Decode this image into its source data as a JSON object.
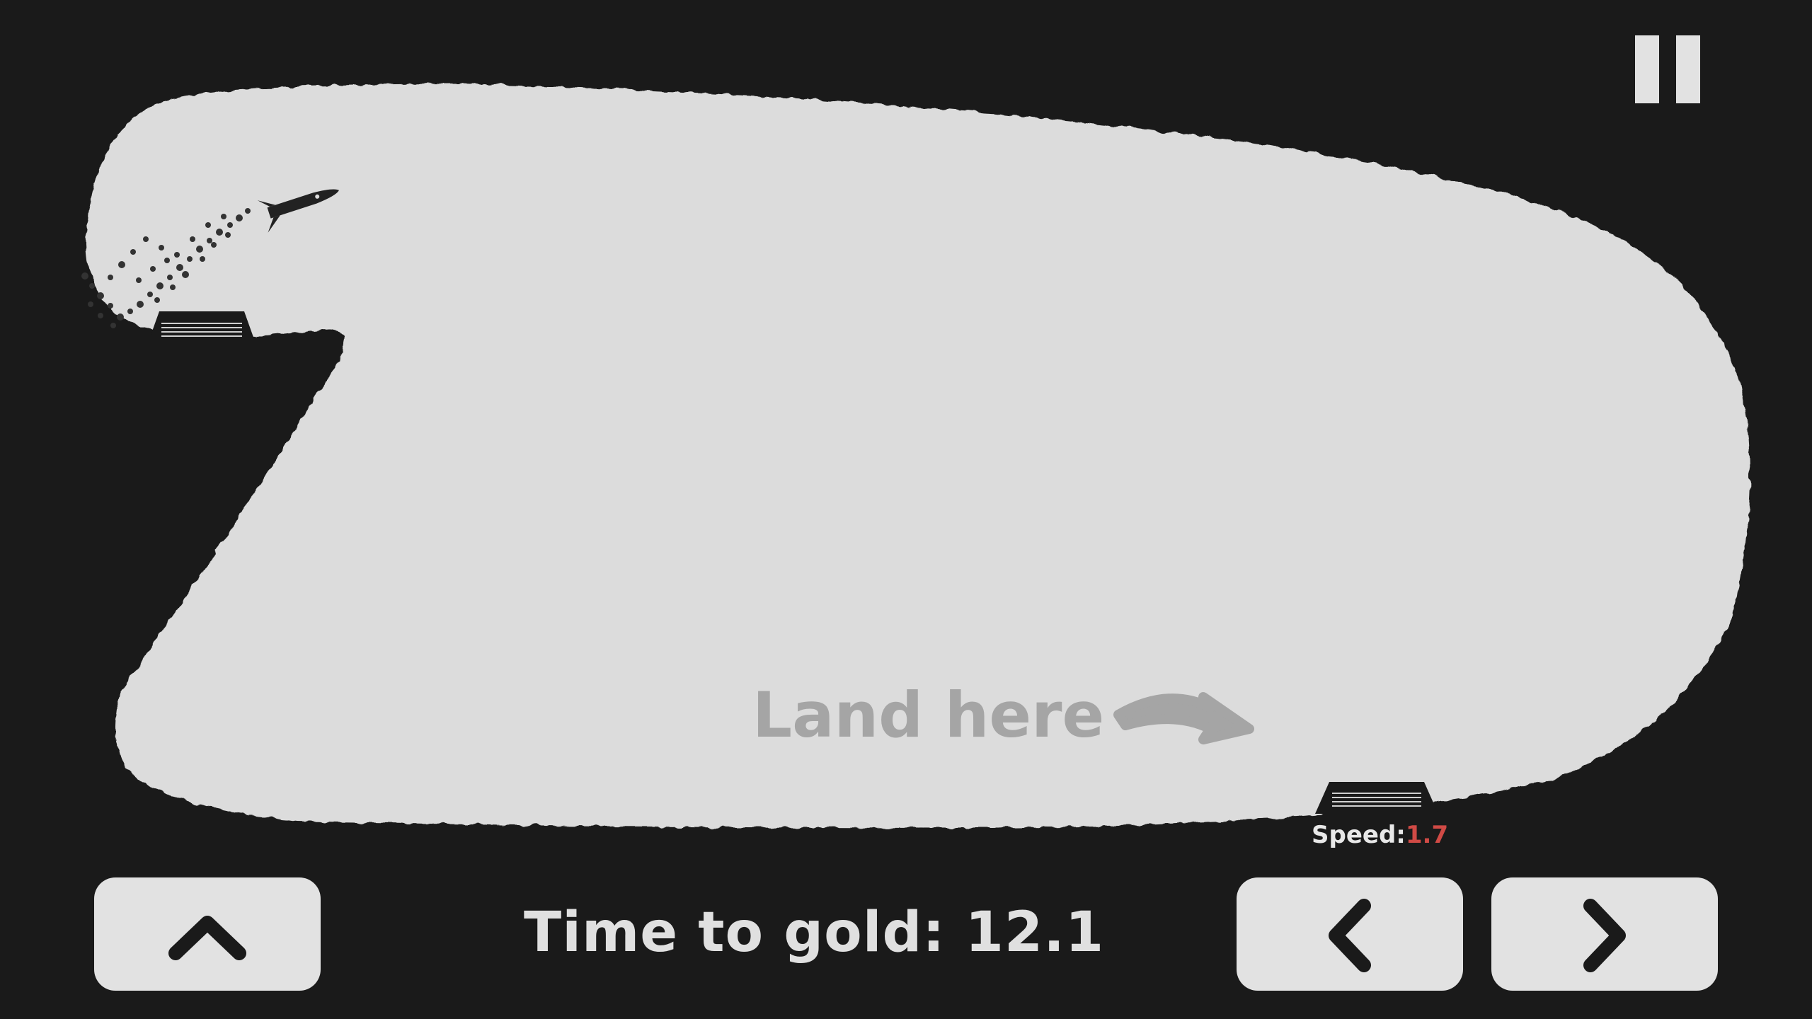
{
  "hud": {
    "timer_label": "Time to gold:",
    "timer_value": "12.1",
    "speed_label": "Speed:",
    "speed_value": "1.7",
    "hint_text": "Land here"
  },
  "controls": {
    "thrust_icon": "chevron-up-icon",
    "left_icon": "chevron-left-icon",
    "right_icon": "chevron-right-icon",
    "pause_icon": "pause-icon"
  },
  "colors": {
    "background": "#1a1a1a",
    "cave": "#dcdcdc",
    "button": "#e2e2e2",
    "hint": "#a5a5a5",
    "speed_value": "#d04a45"
  }
}
